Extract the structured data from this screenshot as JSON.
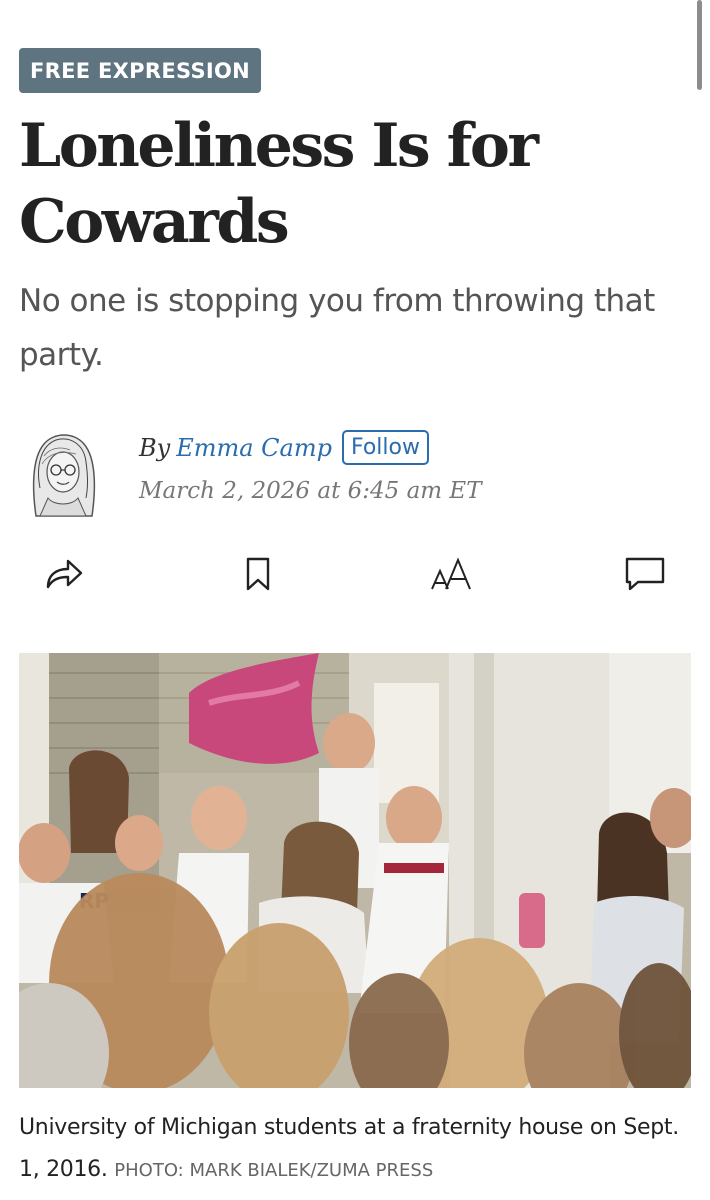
{
  "article": {
    "section_tag": "FREE EXPRESSION",
    "headline": "Loneliness Is for Cowards",
    "subheadline": "No one is stopping you from throwing that party.",
    "byline_prefix": "By",
    "author": "Emma Camp",
    "follow_label": "Follow",
    "date": "March 2, 2026 at 6:45 am ET"
  },
  "toolbar": {
    "icons": [
      "share-icon",
      "bookmark-icon",
      "text-size-icon",
      "comment-icon"
    ]
  },
  "photo": {
    "caption": "University of Michigan students at a fraternity house on Sept. 1, 2016.",
    "credit": "PHOTO: MARK BIALEK/ZUMA PRESS"
  },
  "colors": {
    "tag_bg": "#5e7480",
    "link": "#2a6cad"
  }
}
